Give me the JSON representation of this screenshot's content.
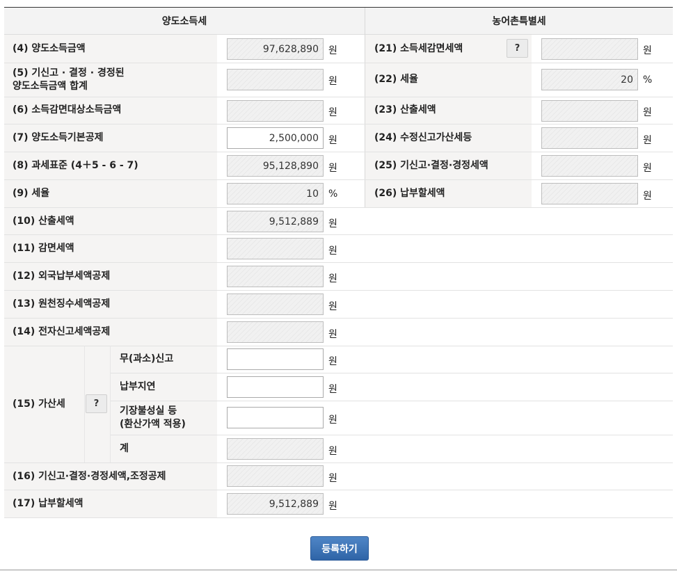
{
  "headers": {
    "left": "양도소득세",
    "right": "농어촌특별세"
  },
  "left_rows": [
    {
      "label": "(4) 양도소득금액",
      "value": "97,628,890",
      "unit": "원"
    },
    {
      "label": "(5) 기신고 · 결정 · 경정된",
      "label2": "양도소득금액 합계",
      "value": "",
      "unit": "원"
    },
    {
      "label": "(6) 소득감면대상소득금액",
      "value": "",
      "unit": "원"
    },
    {
      "label": "(7) 양도소득기본공제",
      "value": "2,500,000",
      "unit": "원"
    },
    {
      "label": "(8) 과세표준 (4＋5 - 6 - 7)",
      "value": "95,128,890",
      "unit": "원"
    },
    {
      "label": "(9) 세율",
      "value": "10",
      "unit": "%"
    },
    {
      "label": "(10) 산출세액",
      "value": "9,512,889",
      "unit": "원"
    },
    {
      "label": "(11) 감면세액",
      "value": "",
      "unit": "원"
    },
    {
      "label": "(12) 외국납부세액공제",
      "value": "",
      "unit": "원"
    },
    {
      "label": "(13) 원천징수세액공제",
      "value": "",
      "unit": "원"
    },
    {
      "label": "(14) 전자신고세액공제",
      "value": "",
      "unit": "원"
    }
  ],
  "gasan": {
    "label": "(15) 가산세",
    "help": "?",
    "sub": [
      {
        "label": "무(과소)신고",
        "value": "",
        "unit": "원"
      },
      {
        "label": "납부지연",
        "value": "",
        "unit": "원"
      },
      {
        "label": "기장불성실 등",
        "label2": "(환산가액 적용)",
        "value": "",
        "unit": "원"
      },
      {
        "label": "계",
        "value": "",
        "unit": "원"
      }
    ]
  },
  "left_bottom": [
    {
      "label": "(16) 기신고·결정·경정세액,조정공제",
      "value": "",
      "unit": "원"
    },
    {
      "label": "(17) 납부할세액",
      "value": "9,512,889",
      "unit": "원"
    }
  ],
  "right_rows": [
    {
      "label": "(21) 소득세감면세액",
      "help": "?",
      "value": "",
      "unit": "원"
    },
    {
      "label": "(22) 세율",
      "value": "20",
      "unit": "%"
    },
    {
      "label": "(23) 산출세액",
      "value": "",
      "unit": "원"
    },
    {
      "label": "(24) 수정신고가산세등",
      "value": "",
      "unit": "원"
    },
    {
      "label": "(25) 기신고·결정·경정세액",
      "value": "",
      "unit": "원"
    },
    {
      "label": "(26) 납부할세액",
      "value": "",
      "unit": "원"
    }
  ],
  "submit_label": "등록하기"
}
